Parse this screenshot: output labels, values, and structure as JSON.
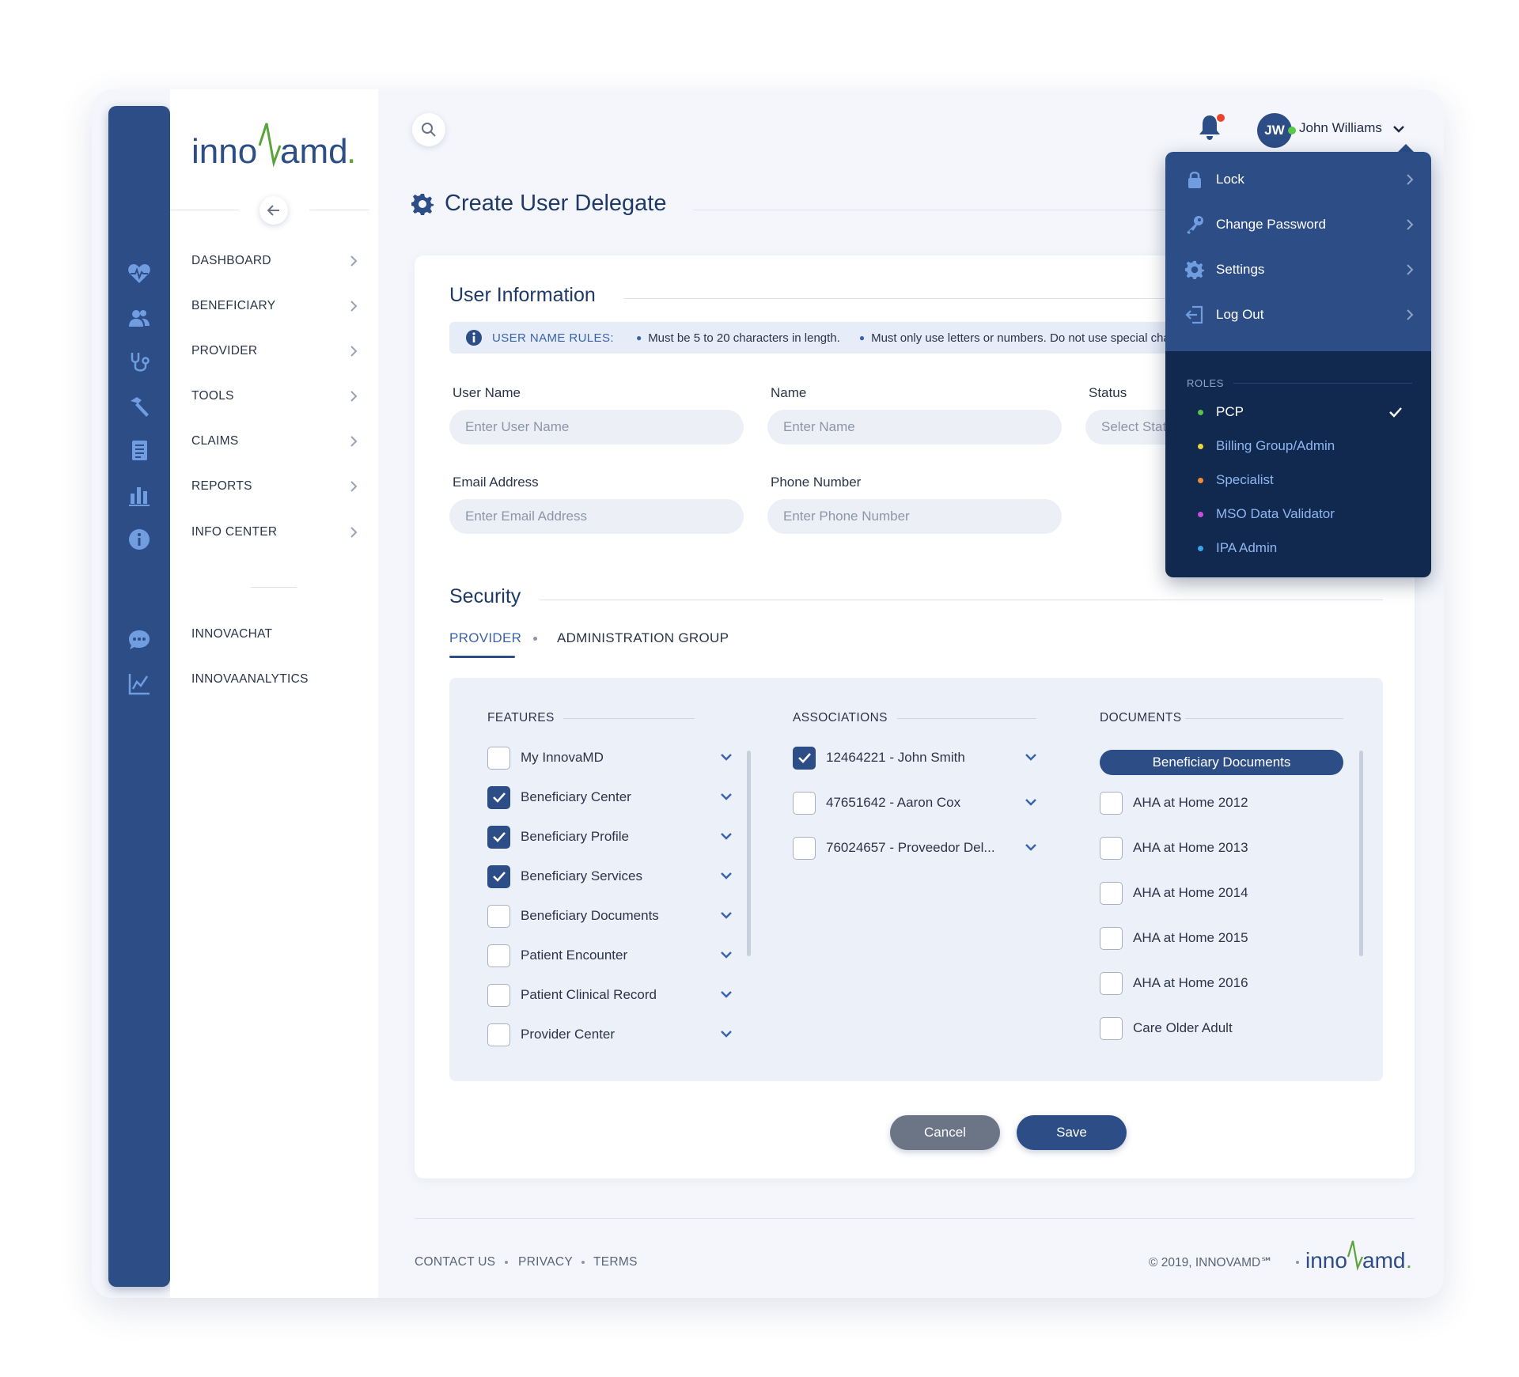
{
  "brand": {
    "logo_text": "innovamd"
  },
  "sidebar": {
    "items": [
      {
        "label": "DASHBOARD",
        "icon": "heart-pulse-icon"
      },
      {
        "label": "BENEFICIARY",
        "icon": "users-icon"
      },
      {
        "label": "PROVIDER",
        "icon": "stethoscope-icon"
      },
      {
        "label": "TOOLS",
        "icon": "hammer-icon"
      },
      {
        "label": "CLAIMS",
        "icon": "document-icon"
      },
      {
        "label": "REPORTS",
        "icon": "bar-chart-icon"
      },
      {
        "label": "INFO CENTER",
        "icon": "info-icon"
      }
    ],
    "extra_items": [
      {
        "label": "INNOVACHAT",
        "icon": "chat-icon"
      },
      {
        "label": "INNOVAANALYTICS",
        "icon": "line-chart-icon"
      }
    ]
  },
  "header": {
    "user_initials": "JW",
    "user_name": "John Williams"
  },
  "page": {
    "title": "Create User Delegate"
  },
  "user_info": {
    "title": "User Information",
    "rules_label": "USER NAME RULES:",
    "rule_1": "Must be 5 to 20 characters in length.",
    "rule_2": "Must only use letters or numbers.  Do not use special characters or spaces.",
    "fields": {
      "username_label": "User Name",
      "username_placeholder": "Enter User Name",
      "name_label": "Name",
      "name_placeholder": "Enter Name",
      "status_label": "Status",
      "status_placeholder": "Select Status",
      "email_label": "Email Address",
      "email_placeholder": "Enter Email Address",
      "phone_label": "Phone Number",
      "phone_placeholder": "Enter Phone Number"
    }
  },
  "security": {
    "title": "Security",
    "tabs": [
      "PROVIDER",
      "ADMINISTRATION GROUP"
    ],
    "features_title": "FEATURES",
    "features": [
      {
        "label": "My InnovaMD",
        "checked": false
      },
      {
        "label": "Beneficiary Center",
        "checked": true
      },
      {
        "label": "Beneficiary Profile",
        "checked": true
      },
      {
        "label": "Beneficiary Services",
        "checked": true
      },
      {
        "label": "Beneficiary Documents",
        "checked": false
      },
      {
        "label": "Patient Encounter",
        "checked": false
      },
      {
        "label": "Patient Clinical Record",
        "checked": false
      },
      {
        "label": "Provider Center",
        "checked": false
      }
    ],
    "associations_title": "ASSOCIATIONS",
    "associations": [
      {
        "label": "12464221 - John Smith",
        "checked": true
      },
      {
        "label": "47651642 - Aaron Cox",
        "checked": false
      },
      {
        "label": "76024657 - Proveedor Del...",
        "checked": false
      }
    ],
    "documents_title": "DOCUMENTS",
    "documents_group": "Beneficiary Documents",
    "documents": [
      {
        "label": "AHA at Home 2012",
        "checked": false
      },
      {
        "label": "AHA at Home 2013",
        "checked": false
      },
      {
        "label": "AHA at Home 2014",
        "checked": false
      },
      {
        "label": "AHA at Home 2015",
        "checked": false
      },
      {
        "label": "AHA at Home 2016",
        "checked": false
      },
      {
        "label": "Care Older Adult",
        "checked": false
      }
    ]
  },
  "actions": {
    "cancel": "Cancel",
    "save": "Save"
  },
  "footer": {
    "links": [
      "CONTACT US",
      "PRIVACY",
      "TERMS"
    ],
    "copyright": "© 2019, INNOVAMD℠"
  },
  "user_menu": {
    "items": [
      {
        "label": "Lock",
        "icon": "lock-icon"
      },
      {
        "label": "Change Password",
        "icon": "key-icon"
      },
      {
        "label": "Settings",
        "icon": "gear-icon"
      },
      {
        "label": "Log Out",
        "icon": "logout-icon"
      }
    ],
    "roles_label": "ROLES",
    "roles": [
      {
        "label": "PCP",
        "color": "#5cc24a",
        "selected": true
      },
      {
        "label": "Billing Group/Admin",
        "color": "#e8d53c",
        "selected": false
      },
      {
        "label": "Specialist",
        "color": "#f08a3c",
        "selected": false
      },
      {
        "label": "MSO Data Validator",
        "color": "#c84fd6",
        "selected": false
      },
      {
        "label": "IPA Admin",
        "color": "#3aa4ea",
        "selected": false
      }
    ]
  },
  "colors": {
    "primary": "#2c4d86",
    "dark_menu": "#12294f",
    "link": "#3b63a8",
    "logo_green": "#5aa53a"
  }
}
